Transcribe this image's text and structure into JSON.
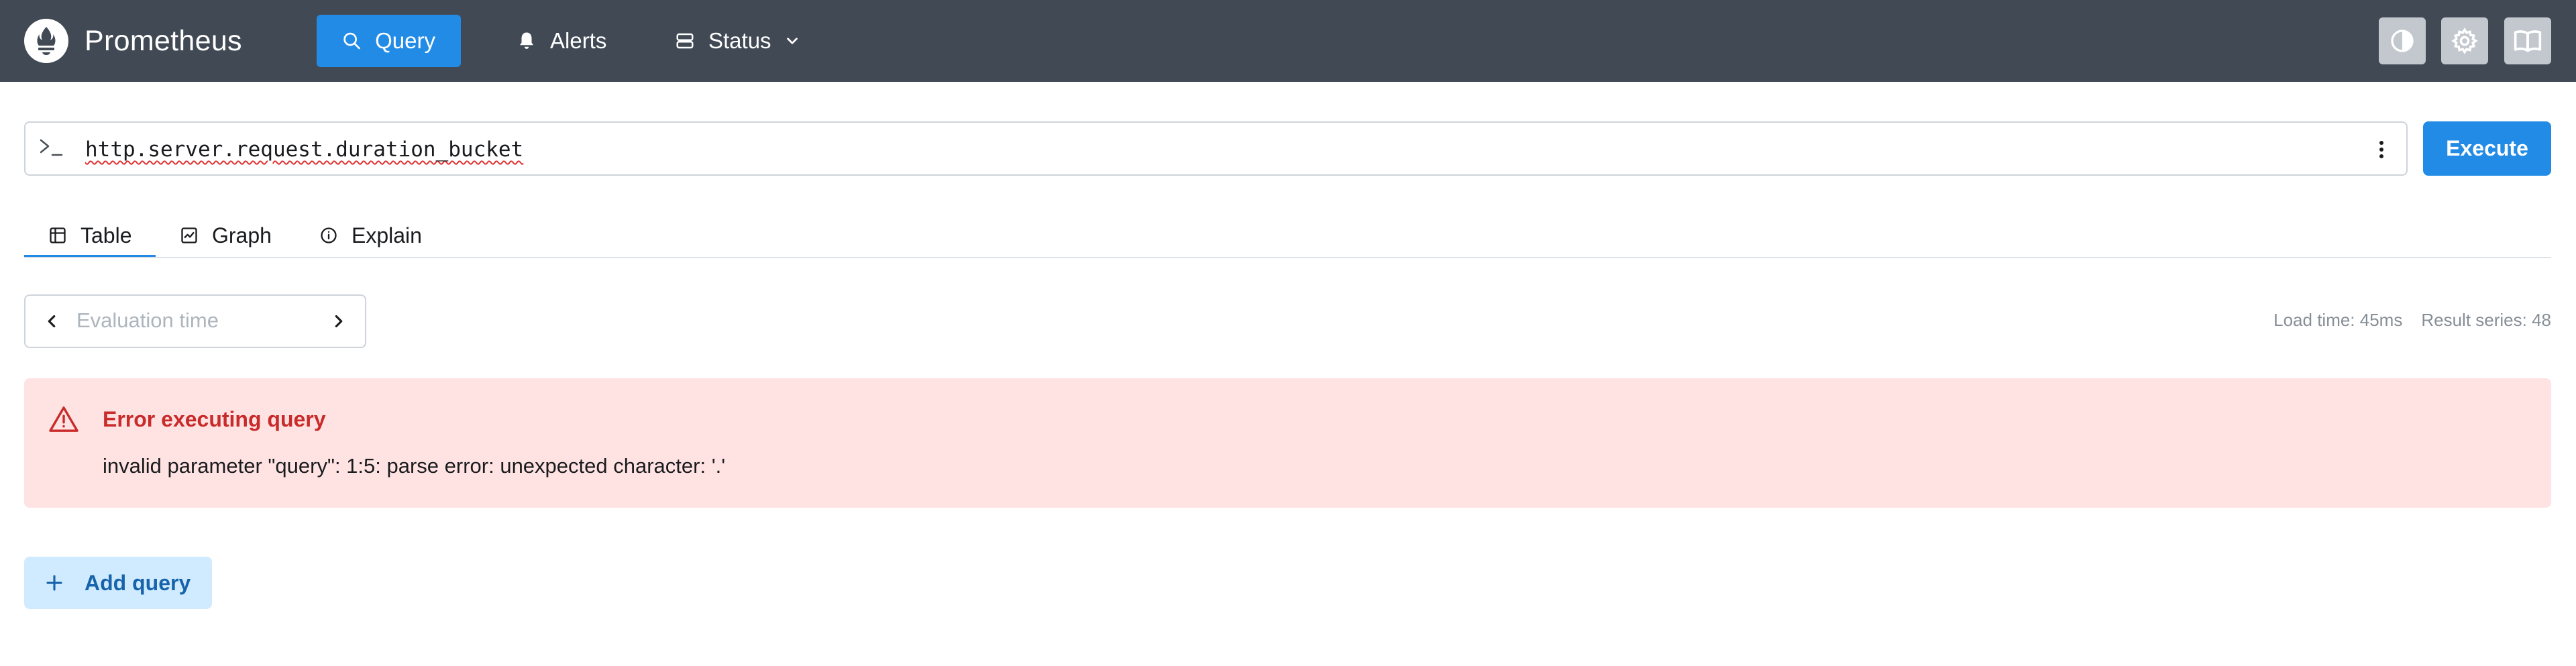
{
  "app": {
    "title": "Prometheus"
  },
  "nav": {
    "items": [
      {
        "label": "Query",
        "icon": "search-icon",
        "active": true
      },
      {
        "label": "Alerts",
        "icon": "bell-icon"
      },
      {
        "label": "Status",
        "icon": "server-icon",
        "dropdown": true
      }
    ],
    "actions": [
      {
        "icon": "theme-toggle-icon"
      },
      {
        "icon": "gear-icon"
      },
      {
        "icon": "book-icon"
      }
    ]
  },
  "query": {
    "expression": "http.server.request.duration_bucket",
    "execute_label": "Execute"
  },
  "tabs": [
    {
      "label": "Table",
      "icon": "table-icon",
      "active": true
    },
    {
      "label": "Graph",
      "icon": "chart-icon"
    },
    {
      "label": "Explain",
      "icon": "info-icon"
    }
  ],
  "evaluation": {
    "placeholder": "Evaluation time"
  },
  "stats": {
    "load_time": "Load time: 45ms",
    "result_series": "Result series: 48"
  },
  "error": {
    "title": "Error executing query",
    "message": "invalid parameter \"query\": 1:5: parse error: unexpected character: '.'"
  },
  "add_query": {
    "label": "Add query"
  },
  "colors": {
    "header_bg": "#414a54",
    "accent": "#228be6",
    "error_bg": "#ffe3e3",
    "error_text": "#c92a2a"
  }
}
